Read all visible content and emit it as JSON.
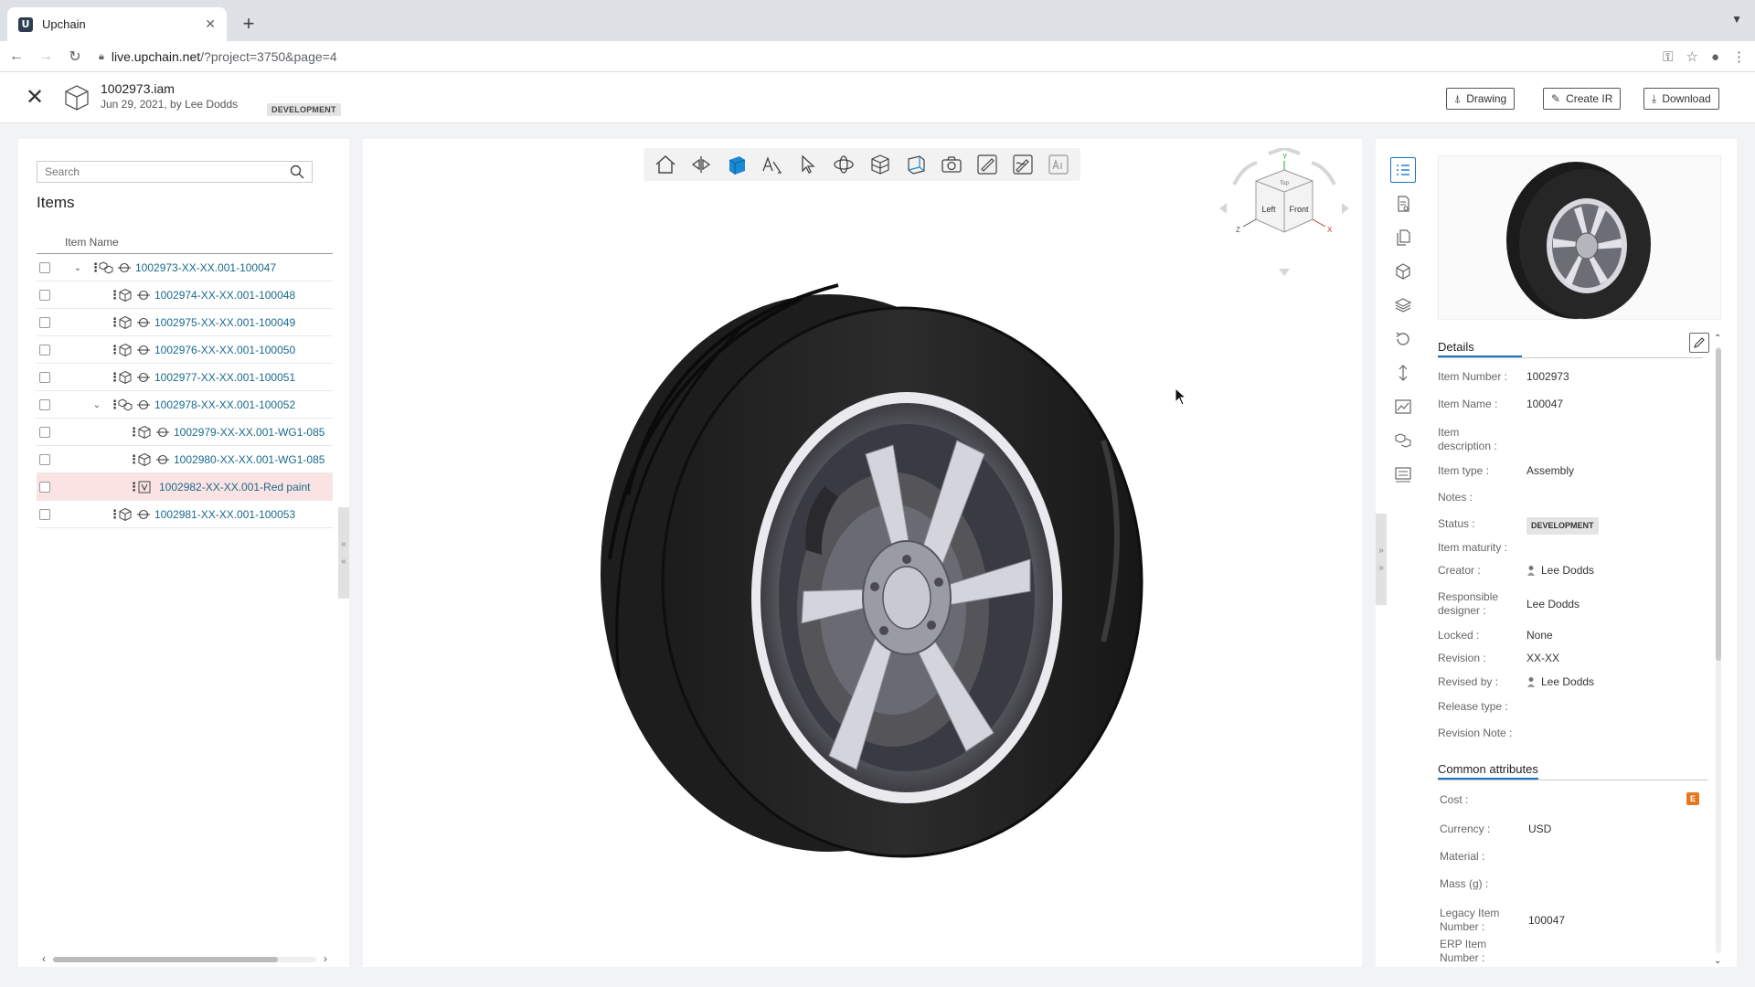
{
  "browser": {
    "tab_title": "Upchain",
    "favicon_letter": "U",
    "url_host": "live.upchain.net",
    "url_path": "/?project=3750&page=4"
  },
  "header": {
    "file_name": "1002973.iam",
    "file_meta": "Jun 29, 2021, by Lee Dodds",
    "badge": "DEVELOPMENT",
    "buttons": {
      "drawing": "Drawing",
      "create_ir": "Create IR",
      "download": "Download"
    }
  },
  "left": {
    "search_placeholder": "Search",
    "title": "Items",
    "column_header": "Item Name",
    "rows": [
      {
        "label": "1002973-XX-XX.001-100047",
        "indent": 0,
        "expandable": true,
        "type": "assembly"
      },
      {
        "label": "1002974-XX-XX.001-100048",
        "indent": 1,
        "expandable": false,
        "type": "part"
      },
      {
        "label": "1002975-XX-XX.001-100049",
        "indent": 1,
        "expandable": false,
        "type": "part"
      },
      {
        "label": "1002976-XX-XX.001-100050",
        "indent": 1,
        "expandable": false,
        "type": "part"
      },
      {
        "label": "1002977-XX-XX.001-100051",
        "indent": 1,
        "expandable": false,
        "type": "part"
      },
      {
        "label": "1002978-XX-XX.001-100052",
        "indent": 1,
        "expandable": true,
        "type": "assembly"
      },
      {
        "label": "1002979-XX-XX.001-WG1-085",
        "indent": 2,
        "expandable": false,
        "type": "part"
      },
      {
        "label": "1002980-XX-XX.001-WG1-085",
        "indent": 2,
        "expandable": false,
        "type": "part"
      },
      {
        "label": "1002982-XX-XX.001-Red paint",
        "indent": 2,
        "expandable": false,
        "type": "variant",
        "highlight": true
      },
      {
        "label": "1002981-XX-XX.001-100053",
        "indent": 1,
        "expandable": false,
        "type": "part"
      }
    ]
  },
  "viewer": {
    "navcube": {
      "left": "Left",
      "front": "Front",
      "top": "Top",
      "axis_x": "X",
      "axis_y": "Y",
      "axis_z": "Z"
    },
    "tools": [
      "home-icon",
      "explode-icon",
      "solid-view-icon",
      "annotate-icon",
      "select-icon",
      "orbit-icon",
      "section-icon",
      "perspective-icon",
      "camera-icon",
      "markup-icon",
      "edit-markup-icon",
      "text-markup-icon"
    ],
    "accent_color": "#1a8ad4"
  },
  "details": {
    "title": "Details",
    "item_number_label": "Item Number :",
    "item_number": "1002973",
    "item_name_label": "Item Name :",
    "item_name": "100047",
    "item_description_label": "Item description :",
    "item_type_label": "Item type :",
    "item_type": "Assembly",
    "notes_label": "Notes :",
    "status_label": "Status :",
    "status": "DEVELOPMENT",
    "maturity_label": "Item maturity :",
    "creator_label": "Creator :",
    "creator": "Lee Dodds",
    "responsible_label": "Responsible designer :",
    "responsible": "Lee Dodds",
    "locked_label": "Locked :",
    "locked": "None",
    "revision_label": "Revision :",
    "revision": "XX-XX",
    "revised_by_label": "Revised by :",
    "revised_by": "Lee Dodds",
    "release_type_label": "Release type :",
    "revision_note_label": "Revision Note :"
  },
  "common": {
    "title": "Common attributes",
    "cost_label": "Cost :",
    "cost_icon": "E",
    "currency_label": "Currency :",
    "currency": "USD",
    "material_label": "Material :",
    "mass_label": "Mass (g) :",
    "legacy_label": "Legacy Item Number :",
    "legacy": "100047",
    "erp_label": "ERP Item Number :"
  }
}
